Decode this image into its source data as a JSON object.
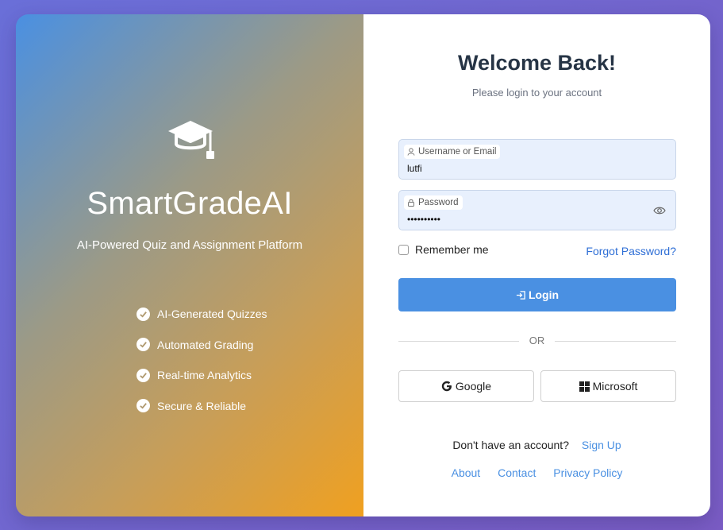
{
  "brand": {
    "name": "SmartGradeAI",
    "tagline": "AI-Powered Quiz and Assignment Platform",
    "logo_icon": "graduation-cap-icon"
  },
  "features": [
    {
      "label": "AI-Generated Quizzes",
      "icon": "check-circle-icon"
    },
    {
      "label": "Automated Grading",
      "icon": "check-circle-icon"
    },
    {
      "label": "Real-time Analytics",
      "icon": "check-circle-icon"
    },
    {
      "label": "Secure & Reliable",
      "icon": "check-circle-icon"
    }
  ],
  "login": {
    "title": "Welcome Back!",
    "subtitle": "Please login to your account",
    "username": {
      "label": "Username or Email",
      "value": "lutfi",
      "icon": "user-icon"
    },
    "password": {
      "label": "Password",
      "value": "••••••••••",
      "icon": "lock-icon",
      "toggle_icon": "eye-icon"
    },
    "remember_label": "Remember me",
    "forgot_label": "Forgot Password?",
    "submit_label": "Login",
    "submit_icon": "login-icon",
    "divider_label": "OR",
    "social": {
      "google": {
        "label": "Google",
        "icon": "google-icon"
      },
      "microsoft": {
        "label": "Microsoft",
        "icon": "microsoft-icon"
      }
    },
    "signup_prompt": "Don't have an account?",
    "signup_label": "Sign Up"
  },
  "footer": {
    "about": "About",
    "contact": "Contact",
    "privacy": "Privacy Policy"
  },
  "colors": {
    "accent": "#4a90e2",
    "title": "#263445",
    "field_bg": "#e8f0fd"
  }
}
